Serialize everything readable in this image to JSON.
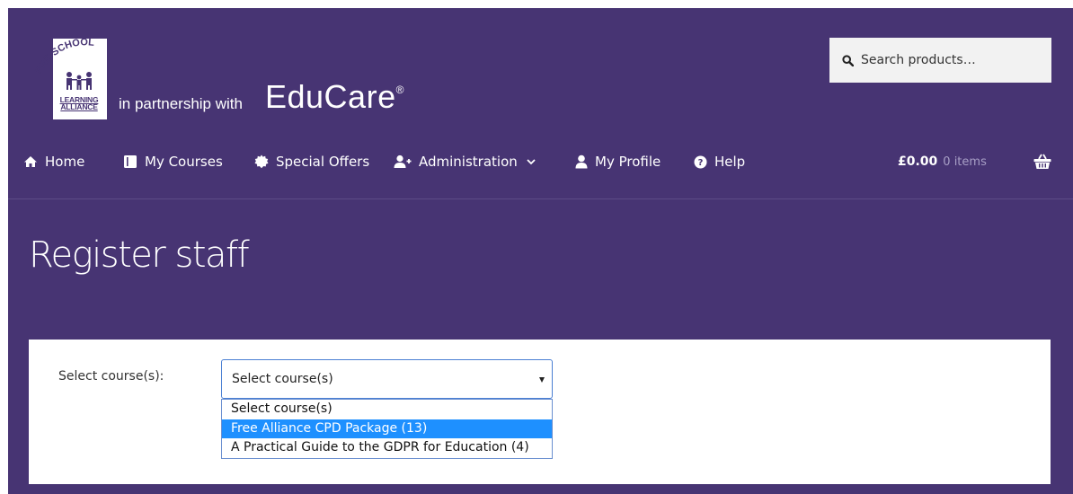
{
  "brand": {
    "logo_arc_text": "PRE SCHOOL",
    "logo_sub_text_1": "LEARNING",
    "logo_sub_text_2": "ALLIANCE",
    "partner_text": "in partnership with",
    "educare": "EduCare",
    "registered_mark": "®"
  },
  "search": {
    "icon": "search-icon",
    "placeholder": "Search products…"
  },
  "nav": {
    "items": [
      {
        "label": "Home",
        "icon": "home-icon"
      },
      {
        "label": "My Courses",
        "icon": "book-icon"
      },
      {
        "label": "Special Offers",
        "icon": "badge-icon"
      },
      {
        "label": "Administration",
        "icon": "user-plus-icon",
        "has_dropdown": true
      },
      {
        "label": "My Profile",
        "icon": "user-icon"
      },
      {
        "label": "Help",
        "icon": "help-icon"
      }
    ],
    "cart_total": "£0.00",
    "cart_count": "0 items",
    "cart_icon": "basket-icon"
  },
  "page": {
    "title": "Register staff"
  },
  "form": {
    "course_label": "Select course(s):",
    "course_selected": "Select course(s)",
    "course_options": [
      "Select course(s)",
      "Free Alliance CPD Package (13)",
      "A Practical Guide to the GDPR for Education (4)"
    ],
    "highlighted_option_index": 1
  },
  "colors": {
    "header_background": "#473473",
    "option_highlight": "#1e90ff",
    "select_border": "#4a7fd3"
  }
}
